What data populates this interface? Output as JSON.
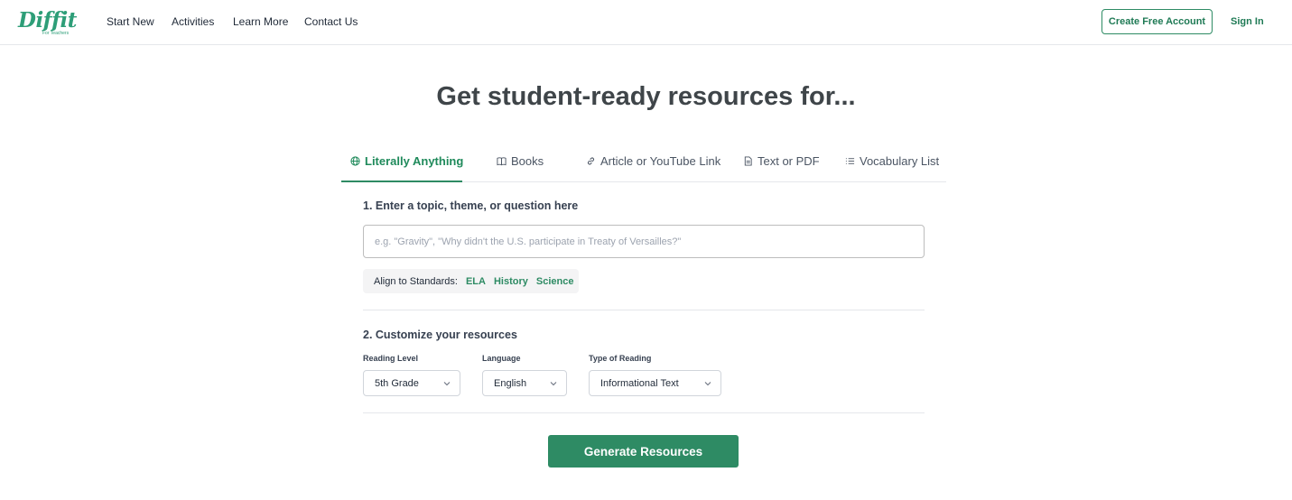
{
  "brand": {
    "name": "Diffit",
    "tagline": "For Teachers",
    "accent": "#2e8b64"
  },
  "nav": {
    "links": [
      "Start New",
      "Activities",
      "Learn More",
      "Contact Us"
    ],
    "create_account": "Create Free Account",
    "sign_in": "Sign In"
  },
  "hero": {
    "title": "Get student-ready resources for..."
  },
  "tabs": [
    {
      "label": "Literally Anything",
      "icon": "globe-icon",
      "active": true
    },
    {
      "label": "Books",
      "icon": "book-icon",
      "active": false
    },
    {
      "label": "Article or YouTube Link",
      "icon": "link-icon",
      "active": false
    },
    {
      "label": "Text or PDF",
      "icon": "document-icon",
      "active": false
    },
    {
      "label": "Vocabulary List",
      "icon": "list-icon",
      "active": false
    }
  ],
  "step1": {
    "title": "1. Enter a topic, theme, or question here",
    "placeholder": "e.g. \"Gravity\", \"Why didn't the U.S. participate in Treaty of Versailles?\"",
    "value": "",
    "standards_label": "Align to Standards:",
    "standards": [
      "ELA",
      "History",
      "Science"
    ]
  },
  "step2": {
    "title": "2. Customize your resources",
    "reading_level": {
      "label": "Reading Level",
      "value": "5th Grade"
    },
    "language": {
      "label": "Language",
      "value": "English"
    },
    "reading_type": {
      "label": "Type of Reading",
      "value": "Informational Text"
    }
  },
  "generate_label": "Generate Resources"
}
